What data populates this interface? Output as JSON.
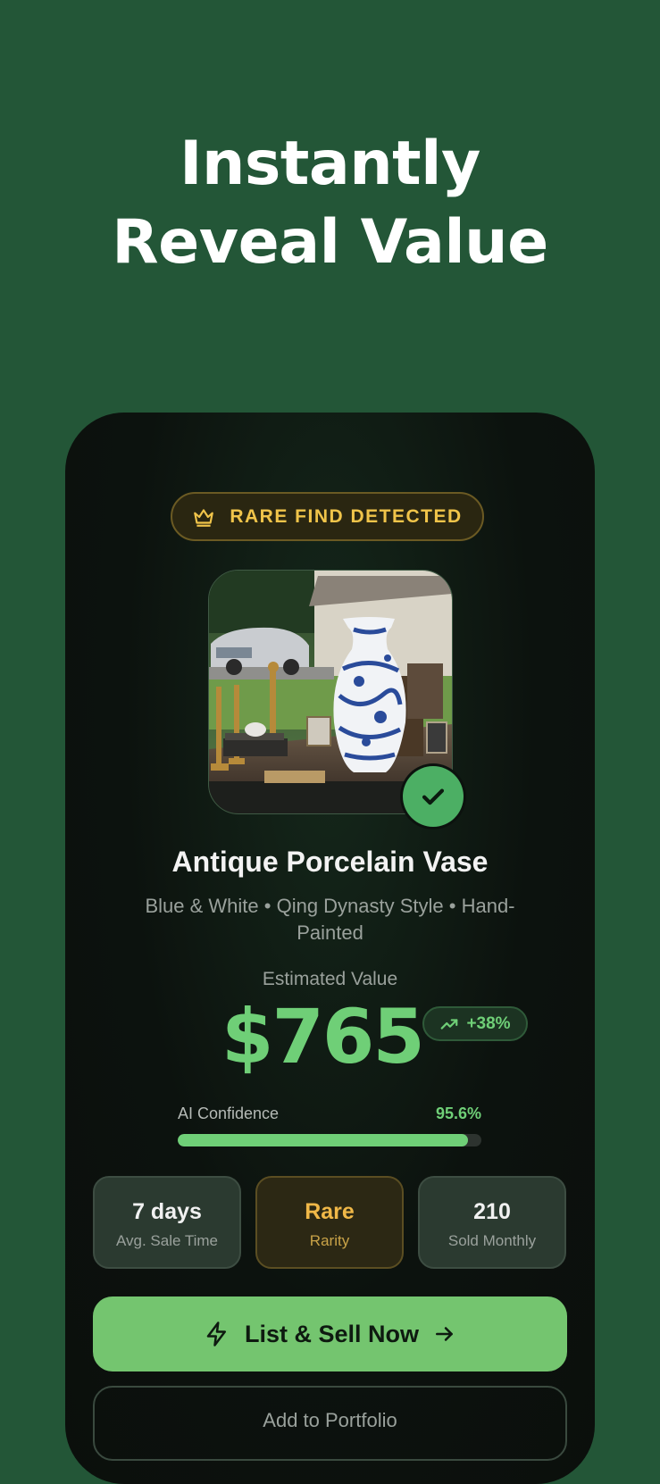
{
  "hero": {
    "line1": "Instantly",
    "line2": "Reveal Value"
  },
  "badge": {
    "label": "RARE FIND DETECTED",
    "icon": "crown-icon"
  },
  "item": {
    "name": "Antique Porcelain Vase",
    "description": "Blue & White • Qing Dynasty Style • Hand-Painted",
    "photo_icon": "vase-photo",
    "verified_icon": "check-icon"
  },
  "valuation": {
    "label": "Estimated Value",
    "price": "$765",
    "trend": "+38%",
    "trend_icon": "trending-up-icon"
  },
  "confidence": {
    "label": "AI Confidence",
    "value": "95.6%",
    "fraction": 0.956
  },
  "stats": [
    {
      "value": "7 days",
      "label": "Avg. Sale Time"
    },
    {
      "value": "Rare",
      "label": "Rarity"
    },
    {
      "value": "210",
      "label": "Sold Monthly"
    }
  ],
  "actions": {
    "primary": "List & Sell Now",
    "primary_icons": [
      "lightning-icon",
      "arrow-right-icon"
    ],
    "secondary": "Add to Portfolio"
  },
  "colors": {
    "background": "#235637",
    "accent": "#6fcf77",
    "gold": "#f0c44a"
  }
}
